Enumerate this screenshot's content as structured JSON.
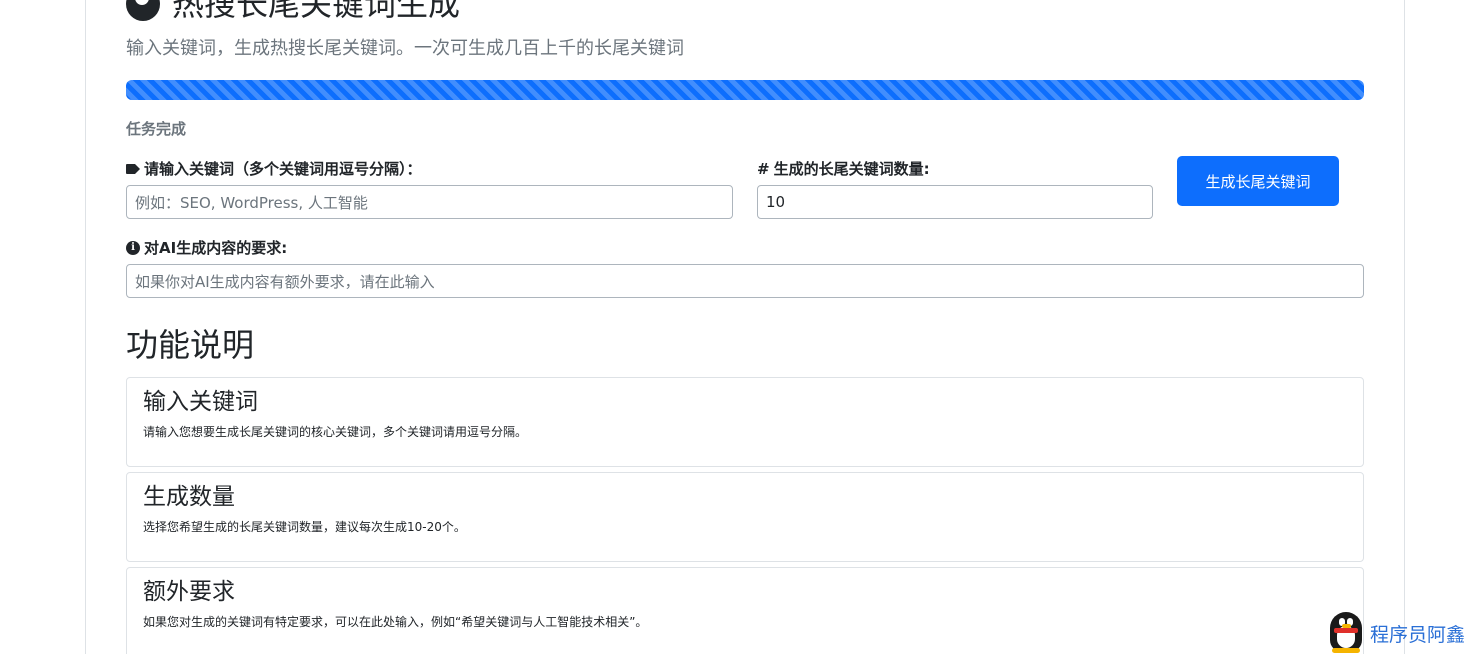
{
  "header": {
    "title": "热搜长尾关键词生成",
    "subtitle": "输入关键词，生成热搜长尾关键词。一次可生成几百上千的长尾关键词"
  },
  "progress": {
    "percent": 100,
    "status": "任务完成",
    "color": "#0d6efd"
  },
  "form": {
    "keywords_label": "请输入关键词（多个关键词用逗号分隔）：",
    "keywords_placeholder": "例如：SEO, WordPress, 人工智能",
    "count_label": "生成的长尾关键词数量:",
    "count_value": "10",
    "requirements_label": "对AI生成内容的要求:",
    "requirements_placeholder": "如果你对AI生成内容有额外要求，请在此输入",
    "submit_label": "生成长尾关键词"
  },
  "features": {
    "title": "功能说明",
    "items": [
      {
        "title": "输入关键词",
        "text": "请输入您想要生成长尾关键词的核心关键词，多个关键词请用逗号分隔。"
      },
      {
        "title": "生成数量",
        "text": "选择您希望生成的长尾关键词数量，建议每次生成10-20个。"
      },
      {
        "title": "额外要求",
        "text": "如果您对生成的关键词有特定要求，可以在此处输入，例如“希望关键词与人工智能技术相关”。"
      }
    ]
  },
  "watermark": {
    "text": "程序员阿鑫",
    "icon": "qq-penguin-icon"
  },
  "icons": {
    "title": "circle-icon",
    "keywords": "tag-icon",
    "count": "hash-icon",
    "requirements": "info-icon"
  },
  "colors": {
    "primary": "#0d6efd",
    "muted": "#6c757d",
    "watermark": "#2a6fd6"
  }
}
